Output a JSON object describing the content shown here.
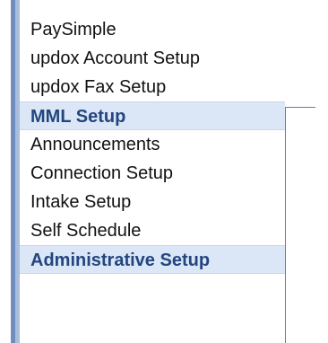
{
  "menu": {
    "items": [
      {
        "label": "PaySimple",
        "type": "item"
      },
      {
        "label": "updox Account Setup",
        "type": "item"
      },
      {
        "label": "updox Fax Setup",
        "type": "item"
      },
      {
        "label": "MML Setup",
        "type": "header"
      },
      {
        "label": "Announcements",
        "type": "item"
      },
      {
        "label": "Connection Setup",
        "type": "item"
      },
      {
        "label": "Intake Setup",
        "type": "item"
      },
      {
        "label": "Self Schedule",
        "type": "item"
      },
      {
        "label": "Administrative Setup",
        "type": "header"
      }
    ]
  },
  "colors": {
    "header_bg": "#dbe6f6",
    "header_text": "#23467f",
    "rail": "#6f8ebd",
    "flyout_border": "#5b7fb8"
  }
}
